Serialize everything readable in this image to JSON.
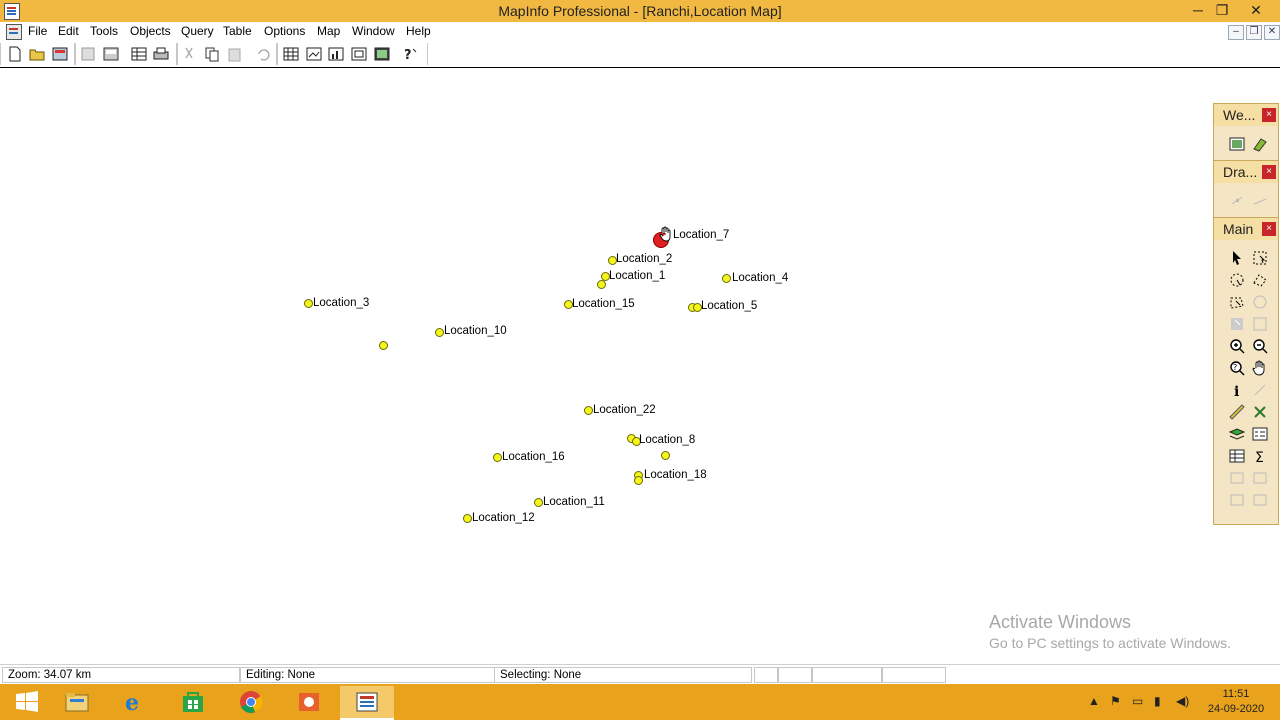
{
  "window": {
    "title": "MapInfo Professional - [Ranchi,Location Map]",
    "controls": {
      "minimize": "─",
      "restore": "❐",
      "close": "✕"
    }
  },
  "menubar": {
    "items": [
      "File",
      "Edit",
      "Tools",
      "Objects",
      "Query",
      "Table",
      "Options",
      "Map",
      "Window",
      "Help"
    ],
    "mdi_controls": {
      "minimize": "–",
      "restore": "❐",
      "close": "✕"
    }
  },
  "toolbar": {
    "buttons": [
      "new-icon",
      "open-icon",
      "open-workspace-icon",
      "save-icon",
      "save-workspace-icon",
      "new-browser-icon",
      "print-icon",
      "cut-icon",
      "copy-icon",
      "paste-icon",
      "undo-icon",
      "browser-window-icon",
      "map-window-icon",
      "graph-window-icon",
      "layout-window-icon",
      "redistricter-icon",
      "help-icon"
    ]
  },
  "map": {
    "locations": [
      {
        "label": "Location_7",
        "selected": true
      },
      {
        "label": "Location_2"
      },
      {
        "label": "Location_1"
      },
      {
        "label": "Location_4"
      },
      {
        "label": "Location_3"
      },
      {
        "label": "Location_15"
      },
      {
        "label": "Location_5"
      },
      {
        "label": "Location_10"
      },
      {
        "label": "Location_22"
      },
      {
        "label": "Location_8"
      },
      {
        "label": "Location_16"
      },
      {
        "label": "Location_18"
      },
      {
        "label": "Location_11"
      },
      {
        "label": "Location_12"
      }
    ]
  },
  "panels": {
    "web": {
      "title": "We...",
      "close": "×"
    },
    "drawing": {
      "title": "Dra...",
      "close": "×"
    },
    "main": {
      "title": "Main",
      "close": "×"
    }
  },
  "watermark": {
    "line1": "Activate Windows",
    "line2": "Go to PC settings to activate Windows."
  },
  "statusbar": {
    "zoom": "Zoom: 34.07 km",
    "editing": "Editing: None",
    "selecting": "Selecting: None"
  },
  "taskbar": {
    "apps": [
      "windows-start-icon",
      "file-explorer-icon",
      "internet-explorer-icon",
      "store-icon",
      "chrome-icon",
      "app-icon",
      "mapinfo-icon"
    ],
    "clock": {
      "time": "11:51",
      "date": "24-09-2020"
    }
  }
}
